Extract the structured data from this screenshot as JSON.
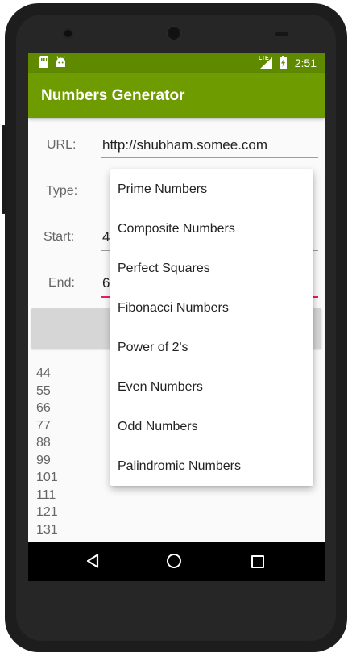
{
  "status_bar": {
    "time": "2:51",
    "network": "LTE",
    "icons": [
      "sd-card-icon",
      "android-icon",
      "lte-signal-icon",
      "battery-charging-icon"
    ]
  },
  "app_bar": {
    "title": "Numbers Generator"
  },
  "form": {
    "url_label": "URL:",
    "url_value": "http://shubham.somee.com",
    "type_label": "Type:",
    "start_label": "Start:",
    "start_value": "4",
    "end_label": "End:",
    "end_value": "6"
  },
  "dropdown": {
    "options": [
      "Prime Numbers",
      "Composite Numbers",
      "Perfect Squares",
      "Fibonacci Numbers",
      "Power of 2's",
      "Even Numbers",
      "Odd Numbers",
      "Palindromic Numbers"
    ]
  },
  "results": [
    "44",
    "55",
    "66",
    "77",
    "88",
    "99",
    "101",
    "111",
    "121",
    "131"
  ],
  "colors": {
    "status_bar": "#5f8a00",
    "app_bar": "#6e9b00",
    "accent": "#e91e63"
  }
}
